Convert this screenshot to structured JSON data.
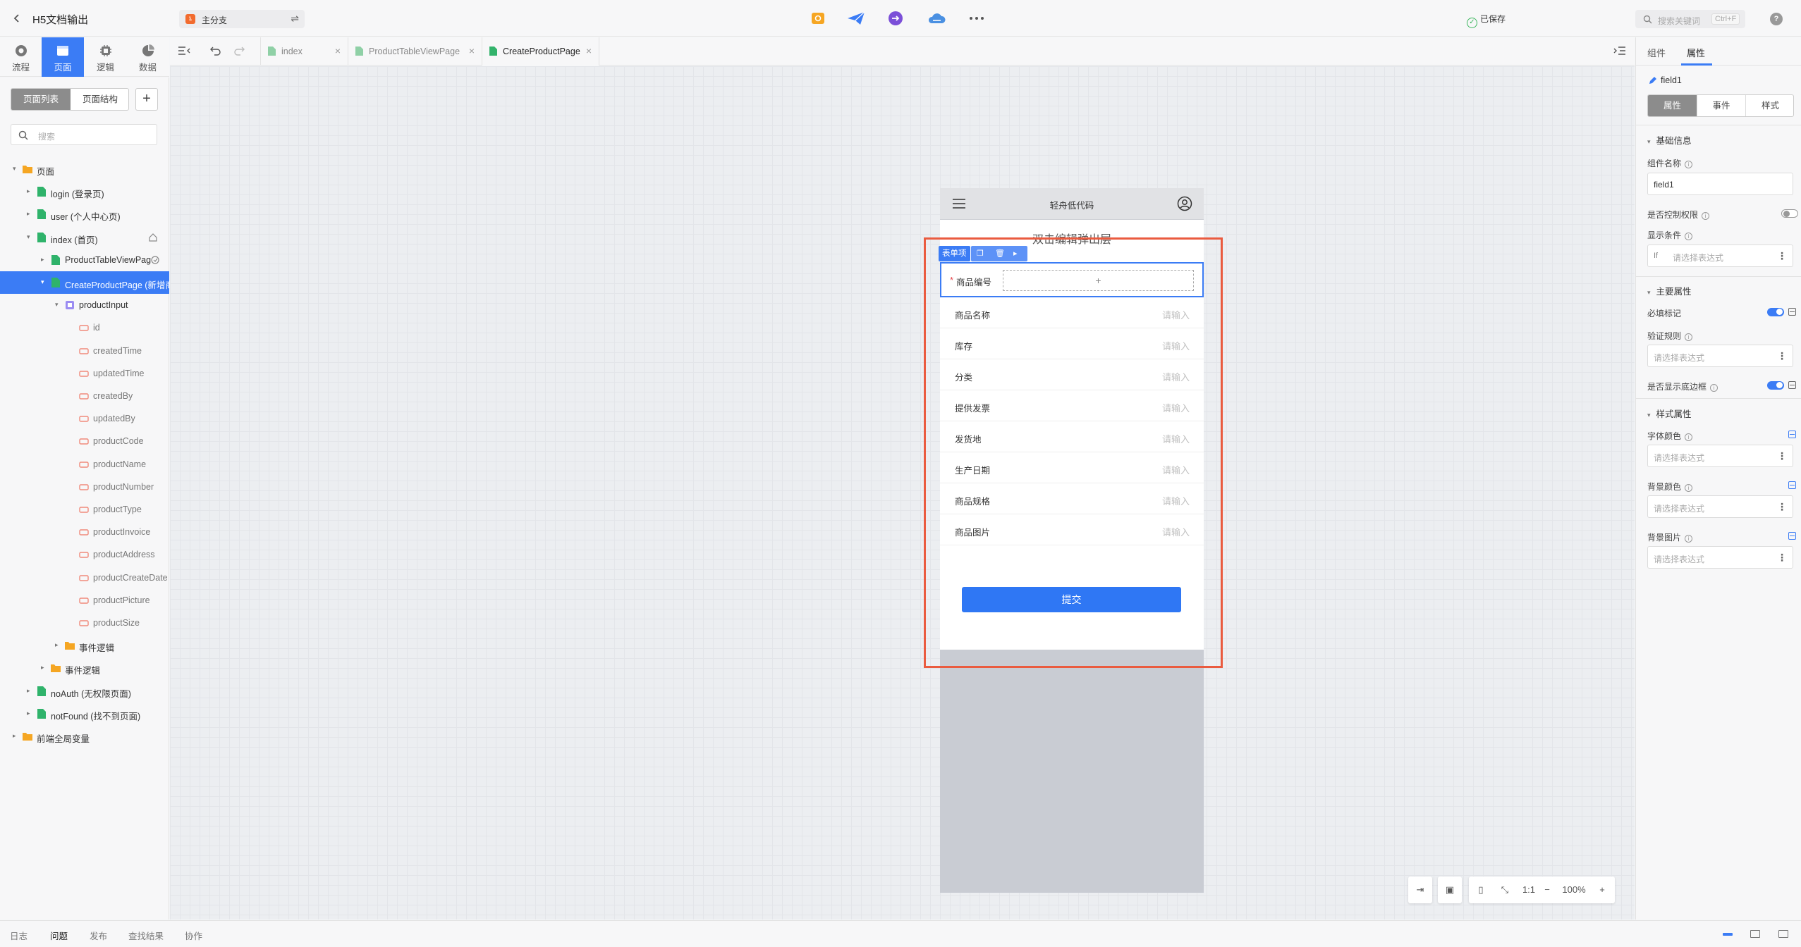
{
  "app": {
    "title": "H5文档输出",
    "branch": "主分支",
    "branch_icon": "branch-icon",
    "saved_status": "已保存",
    "search_placeholder": "搜索关键词",
    "search_shortcut": "Ctrl+F",
    "help": "?"
  },
  "left_nav": {
    "tabs": [
      {
        "label": "流程",
        "icon": "flow-icon"
      },
      {
        "label": "页面",
        "icon": "page-icon",
        "active": true
      },
      {
        "label": "逻辑",
        "icon": "logic-icon"
      },
      {
        "label": "数据",
        "icon": "data-icon"
      }
    ]
  },
  "left_panel": {
    "seg": [
      "页面列表",
      "页面结构"
    ],
    "add": "+",
    "search_placeholder": "搜索",
    "tree": [
      {
        "label": "页面",
        "kind": "folder"
      },
      {
        "label": "login (登录页)",
        "kind": "page"
      },
      {
        "label": "user (个人中心页)",
        "kind": "page"
      },
      {
        "label": "index (首页)",
        "kind": "page"
      },
      {
        "label": "ProductTableViewPag",
        "kind": "page"
      },
      {
        "label": "CreateProductPage (新增商",
        "kind": "page",
        "selected": true
      },
      {
        "label": "productInput",
        "kind": "component"
      },
      {
        "label": "id",
        "kind": "field"
      },
      {
        "label": "createdTime",
        "kind": "field"
      },
      {
        "label": "updatedTime",
        "kind": "field"
      },
      {
        "label": "createdBy",
        "kind": "field"
      },
      {
        "label": "updatedBy",
        "kind": "field"
      },
      {
        "label": "productCode",
        "kind": "field"
      },
      {
        "label": "productName",
        "kind": "field"
      },
      {
        "label": "productNumber",
        "kind": "field"
      },
      {
        "label": "productType",
        "kind": "field"
      },
      {
        "label": "productInvoice",
        "kind": "field"
      },
      {
        "label": "productAddress",
        "kind": "field"
      },
      {
        "label": "productCreateDate",
        "kind": "field"
      },
      {
        "label": "productPicture",
        "kind": "field"
      },
      {
        "label": "productSize",
        "kind": "field"
      },
      {
        "label": "事件逻辑",
        "kind": "folder"
      },
      {
        "label": "事件逻辑",
        "kind": "folder"
      },
      {
        "label": "noAuth (无权限页面)",
        "kind": "page"
      },
      {
        "label": "notFound (找不到页面)",
        "kind": "page"
      },
      {
        "label": "前端全局变量",
        "kind": "folder"
      }
    ]
  },
  "tabs": [
    {
      "label": "index"
    },
    {
      "label": "ProductTableViewPage"
    },
    {
      "label": "CreateProductPage",
      "active": true
    }
  ],
  "canvas": {
    "phone_title": "轻舟低代码",
    "dialog_title": "双击编辑弹出层",
    "component_tag": "表单项",
    "first_field": {
      "label": "商品编号",
      "required": "*",
      "slot": "+"
    },
    "fields": [
      {
        "label": "商品名称",
        "placeholder": "请输入"
      },
      {
        "label": "库存",
        "placeholder": "请输入"
      },
      {
        "label": "分类",
        "placeholder": "请输入"
      },
      {
        "label": "提供发票",
        "placeholder": "请输入"
      },
      {
        "label": "发货地",
        "placeholder": "请输入"
      },
      {
        "label": "生产日期",
        "placeholder": "请输入"
      },
      {
        "label": "商品规格",
        "placeholder": "请输入"
      },
      {
        "label": "商品图片",
        "placeholder": "请输入"
      }
    ],
    "submit": "提交",
    "zoom": "100%",
    "ratio": "1:1",
    "highlight_color": "#ea5b3f",
    "accent": "#3b7cf5"
  },
  "right_panel": {
    "tabs": [
      "组件",
      "属性"
    ],
    "active_tab": "属性",
    "component_name": "field1",
    "seg": [
      "属性",
      "事件",
      "样式"
    ],
    "sections": {
      "basic": "基础信息",
      "main": "主要属性",
      "style": "样式属性"
    },
    "props": {
      "name_label": "组件名称",
      "name_value": "field1",
      "permission_label": "是否控制权限",
      "permission_on": false,
      "condition_label": "显示条件",
      "condition_prefix": "If",
      "condition_placeholder": "请选择表达式",
      "required_label": "必填标记",
      "required_on": true,
      "rules_label": "验证规则",
      "rules_placeholder": "请选择表达式",
      "border_label": "是否显示底边框",
      "border_on": true,
      "font_color_label": "字体颜色",
      "font_color_placeholder": "请选择表达式",
      "bg_color_label": "背景颜色",
      "bg_color_placeholder": "请选择表达式",
      "bg_image_label": "背景图片",
      "bg_image_placeholder": "请选择表达式"
    }
  },
  "bottom": {
    "tabs": [
      "日志",
      "问题",
      "发布",
      "查找结果",
      "协作"
    ],
    "active": "问题"
  }
}
